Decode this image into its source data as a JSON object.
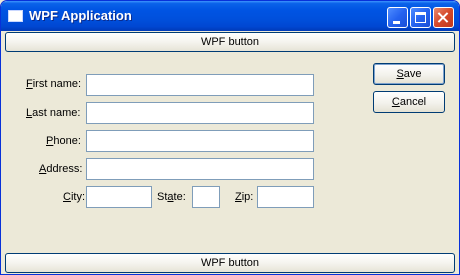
{
  "window": {
    "title": "WPF Application"
  },
  "top_button": {
    "label": "WPF button"
  },
  "bottom_button": {
    "label": "WPF button"
  },
  "form": {
    "first_name": {
      "mnemonic": "F",
      "rest": "irst name:",
      "value": ""
    },
    "last_name": {
      "mnemonic": "L",
      "rest": "ast name:",
      "value": ""
    },
    "phone": {
      "mnemonic": "P",
      "rest": "hone:",
      "value": ""
    },
    "address": {
      "mnemonic": "A",
      "rest": "ddress:",
      "value": ""
    },
    "city": {
      "pre": "",
      "mnemonic": "C",
      "rest": "ity:",
      "value": ""
    },
    "state": {
      "pre": "St",
      "mnemonic": "a",
      "rest": "te:",
      "value": ""
    },
    "zip": {
      "mnemonic": "Z",
      "rest": "ip:",
      "value": ""
    }
  },
  "actions": {
    "save": {
      "mnemonic": "S",
      "rest": "ave"
    },
    "cancel": {
      "mnemonic": "C",
      "rest": "ancel"
    }
  }
}
